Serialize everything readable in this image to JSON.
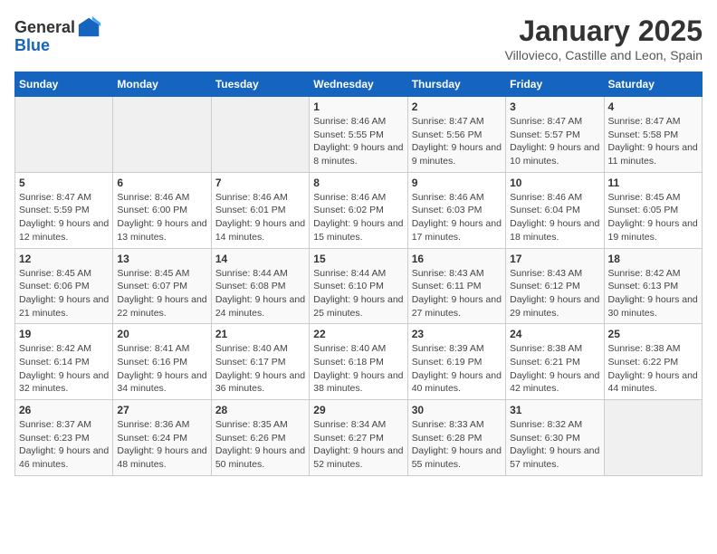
{
  "header": {
    "logo_general": "General",
    "logo_blue": "Blue",
    "month": "January 2025",
    "location": "Villovieco, Castille and Leon, Spain"
  },
  "weekdays": [
    "Sunday",
    "Monday",
    "Tuesday",
    "Wednesday",
    "Thursday",
    "Friday",
    "Saturday"
  ],
  "weeks": [
    [
      {
        "day": "",
        "info": ""
      },
      {
        "day": "",
        "info": ""
      },
      {
        "day": "",
        "info": ""
      },
      {
        "day": "1",
        "info": "Sunrise: 8:46 AM\nSunset: 5:55 PM\nDaylight: 9 hours and 8 minutes."
      },
      {
        "day": "2",
        "info": "Sunrise: 8:47 AM\nSunset: 5:56 PM\nDaylight: 9 hours and 9 minutes."
      },
      {
        "day": "3",
        "info": "Sunrise: 8:47 AM\nSunset: 5:57 PM\nDaylight: 9 hours and 10 minutes."
      },
      {
        "day": "4",
        "info": "Sunrise: 8:47 AM\nSunset: 5:58 PM\nDaylight: 9 hours and 11 minutes."
      }
    ],
    [
      {
        "day": "5",
        "info": "Sunrise: 8:47 AM\nSunset: 5:59 PM\nDaylight: 9 hours and 12 minutes."
      },
      {
        "day": "6",
        "info": "Sunrise: 8:46 AM\nSunset: 6:00 PM\nDaylight: 9 hours and 13 minutes."
      },
      {
        "day": "7",
        "info": "Sunrise: 8:46 AM\nSunset: 6:01 PM\nDaylight: 9 hours and 14 minutes."
      },
      {
        "day": "8",
        "info": "Sunrise: 8:46 AM\nSunset: 6:02 PM\nDaylight: 9 hours and 15 minutes."
      },
      {
        "day": "9",
        "info": "Sunrise: 8:46 AM\nSunset: 6:03 PM\nDaylight: 9 hours and 17 minutes."
      },
      {
        "day": "10",
        "info": "Sunrise: 8:46 AM\nSunset: 6:04 PM\nDaylight: 9 hours and 18 minutes."
      },
      {
        "day": "11",
        "info": "Sunrise: 8:45 AM\nSunset: 6:05 PM\nDaylight: 9 hours and 19 minutes."
      }
    ],
    [
      {
        "day": "12",
        "info": "Sunrise: 8:45 AM\nSunset: 6:06 PM\nDaylight: 9 hours and 21 minutes."
      },
      {
        "day": "13",
        "info": "Sunrise: 8:45 AM\nSunset: 6:07 PM\nDaylight: 9 hours and 22 minutes."
      },
      {
        "day": "14",
        "info": "Sunrise: 8:44 AM\nSunset: 6:08 PM\nDaylight: 9 hours and 24 minutes."
      },
      {
        "day": "15",
        "info": "Sunrise: 8:44 AM\nSunset: 6:10 PM\nDaylight: 9 hours and 25 minutes."
      },
      {
        "day": "16",
        "info": "Sunrise: 8:43 AM\nSunset: 6:11 PM\nDaylight: 9 hours and 27 minutes."
      },
      {
        "day": "17",
        "info": "Sunrise: 8:43 AM\nSunset: 6:12 PM\nDaylight: 9 hours and 29 minutes."
      },
      {
        "day": "18",
        "info": "Sunrise: 8:42 AM\nSunset: 6:13 PM\nDaylight: 9 hours and 30 minutes."
      }
    ],
    [
      {
        "day": "19",
        "info": "Sunrise: 8:42 AM\nSunset: 6:14 PM\nDaylight: 9 hours and 32 minutes."
      },
      {
        "day": "20",
        "info": "Sunrise: 8:41 AM\nSunset: 6:16 PM\nDaylight: 9 hours and 34 minutes."
      },
      {
        "day": "21",
        "info": "Sunrise: 8:40 AM\nSunset: 6:17 PM\nDaylight: 9 hours and 36 minutes."
      },
      {
        "day": "22",
        "info": "Sunrise: 8:40 AM\nSunset: 6:18 PM\nDaylight: 9 hours and 38 minutes."
      },
      {
        "day": "23",
        "info": "Sunrise: 8:39 AM\nSunset: 6:19 PM\nDaylight: 9 hours and 40 minutes."
      },
      {
        "day": "24",
        "info": "Sunrise: 8:38 AM\nSunset: 6:21 PM\nDaylight: 9 hours and 42 minutes."
      },
      {
        "day": "25",
        "info": "Sunrise: 8:38 AM\nSunset: 6:22 PM\nDaylight: 9 hours and 44 minutes."
      }
    ],
    [
      {
        "day": "26",
        "info": "Sunrise: 8:37 AM\nSunset: 6:23 PM\nDaylight: 9 hours and 46 minutes."
      },
      {
        "day": "27",
        "info": "Sunrise: 8:36 AM\nSunset: 6:24 PM\nDaylight: 9 hours and 48 minutes."
      },
      {
        "day": "28",
        "info": "Sunrise: 8:35 AM\nSunset: 6:26 PM\nDaylight: 9 hours and 50 minutes."
      },
      {
        "day": "29",
        "info": "Sunrise: 8:34 AM\nSunset: 6:27 PM\nDaylight: 9 hours and 52 minutes."
      },
      {
        "day": "30",
        "info": "Sunrise: 8:33 AM\nSunset: 6:28 PM\nDaylight: 9 hours and 55 minutes."
      },
      {
        "day": "31",
        "info": "Sunrise: 8:32 AM\nSunset: 6:30 PM\nDaylight: 9 hours and 57 minutes."
      },
      {
        "day": "",
        "info": ""
      }
    ]
  ]
}
